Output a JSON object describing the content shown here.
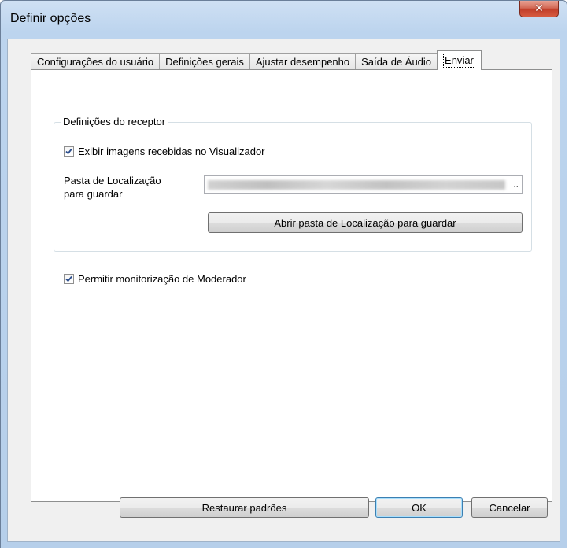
{
  "window": {
    "title": "Definir opções"
  },
  "tabs": [
    {
      "label": "Configurações do usuário",
      "active": false
    },
    {
      "label": "Definições gerais",
      "active": false
    },
    {
      "label": "Ajustar desempenho",
      "active": false
    },
    {
      "label": "Saída de Áudio",
      "active": false
    },
    {
      "label": "Enviar",
      "active": true
    }
  ],
  "receiver": {
    "group_title": "Definições do receptor",
    "show_images_label": "Exibir imagens recebidas no Visualizador",
    "show_images_checked": true,
    "folder_label_line1": "Pasta de Localização",
    "folder_label_line2": "para guardar",
    "folder_path_suffix": "..",
    "open_folder_button": "Abrir pasta de Localização para guardar"
  },
  "moderator": {
    "allow_label": "Permitir monitorização de Moderador",
    "allow_checked": true
  },
  "footer": {
    "restore_button": "Restaurar padrões",
    "ok_button": "OK",
    "cancel_button": "Cancelar"
  },
  "icons": {
    "close": "close-icon",
    "check": "checkmark-icon"
  }
}
